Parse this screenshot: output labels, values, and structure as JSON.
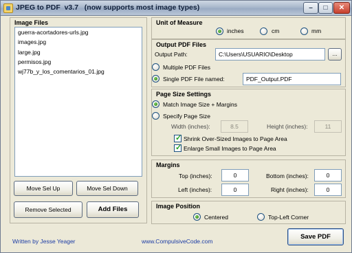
{
  "window": {
    "title": "JPEG to PDF  v3.7   (now supports most image types)",
    "minimize_glyph": "–",
    "maximize_glyph": "□",
    "close_glyph": "✕"
  },
  "image_files": {
    "title": "Image Files",
    "items": [
      "guerra-acortadores-urls.jpg",
      "images.jpg",
      "large.jpg",
      "permisos.jpg",
      "wj77b_y_los_comentarios_01.jpg"
    ],
    "move_up_label": "Move Sel Up",
    "move_down_label": "Move Sel Down",
    "remove_label": "Remove Selected",
    "add_label": "Add Files"
  },
  "unit_of_measure": {
    "title": "Unit of Measure",
    "options": [
      "inches",
      "cm",
      "mm"
    ],
    "selected": "inches"
  },
  "output": {
    "title": "Output PDF Files",
    "path_label": "Output Path:",
    "path_value": "C:\\Users\\USUARIO\\Desktop",
    "browse_label": "...",
    "multiple_label": "Multiple PDF Files",
    "single_label": "Single PDF File named:",
    "single_value": "PDF_Output.PDF",
    "selected": "single"
  },
  "page_size": {
    "title": "Page Size Settings",
    "match_label": "Match Image Size + Margins",
    "specify_label": "Specify Page Size",
    "width_label": "Width (inches):",
    "width_value": "8.5",
    "height_label": "Height (inches):",
    "height_value": "11",
    "shrink_label": "Shrink Over-Sized Images to Page Area",
    "enlarge_label": "Enlarge Small Images to Page Area",
    "selected": "match"
  },
  "margins": {
    "title": "Margins",
    "top_label": "Top (inches):",
    "top_value": "0",
    "bottom_label": "Bottom (inches):",
    "bottom_value": "0",
    "left_label": "Left (inches):",
    "left_value": "0",
    "right_label": "Right (inches):",
    "right_value": "0"
  },
  "image_position": {
    "title": "Image Position",
    "centered_label": "Centered",
    "topleft_label": "Top-Left Corner",
    "selected": "centered"
  },
  "footer": {
    "author": "Written by Jesse Yeager",
    "website": "www.CompulsiveCode.com",
    "save_label": "Save PDF"
  }
}
